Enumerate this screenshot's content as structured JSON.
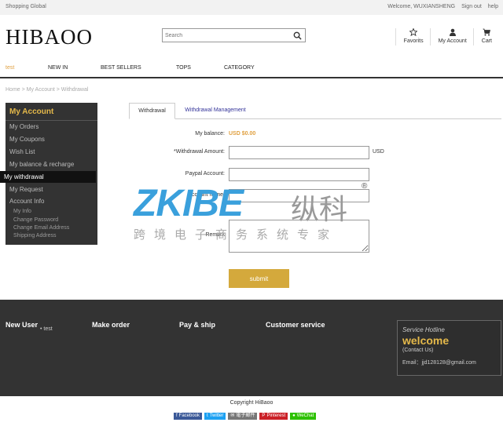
{
  "topbar": {
    "left": "Shopping Global",
    "welcome": "Welcome, WUXIANSHENG",
    "signout": "Sign out",
    "help": "help"
  },
  "header": {
    "logo": "HIBAOO",
    "search_placeholder": "Search",
    "favorites": "Favorits",
    "account": "My Account",
    "cart": "Cart"
  },
  "nav": [
    "test",
    "NEW IN",
    "BEST SELLERS",
    "TOPS",
    "CATEGORY"
  ],
  "breadcrumb": "Home > My Account > Withdrawal",
  "sidebar": {
    "title": "My Account",
    "items": [
      "My Orders",
      "My Coupons",
      "Wish List",
      "My balance & recharge",
      "My withdrawal",
      "My Request",
      "Account Info"
    ],
    "sub_items": [
      "My Info",
      "Change Password",
      "Change Email Address",
      "Shipping Address"
    ]
  },
  "tabs": {
    "active": "Withdrawal",
    "inactive": "Withdrawal Management"
  },
  "form": {
    "balance_label": "My balance:",
    "balance_value": "USD $0.00",
    "amount_label": "*Withdrawal Amount:",
    "amount_unit": "USD",
    "paypal_label": "Paypal Account:",
    "account_name_label": "Account name:",
    "remark_label": "Remark",
    "submit": "submit"
  },
  "watermark": {
    "text": "ZKIBE",
    "chinese": "纵科",
    "subtitle": "跨境电子商务系统专家",
    "reg": "®"
  },
  "footer": {
    "columns": [
      "New User",
      "Make order",
      "Pay & ship",
      "Customer service"
    ],
    "new_user_sub": "• test",
    "hotline_title": "Service Hotline",
    "hotline_big": "welcome",
    "hotline_contact": "(Contact Us)",
    "hotline_email": "Email：jjd128128@gmail.com"
  },
  "copyright": "Copyright HiBaoo",
  "share": [
    {
      "label": "Facebook",
      "color": "#3b5998"
    },
    {
      "label": "Twitter",
      "color": "#1da1f2"
    },
    {
      "label": "電子郵件",
      "color": "#777777"
    },
    {
      "label": "Pinterest",
      "color": "#cb2027"
    },
    {
      "label": "WeChat",
      "color": "#2dc100"
    }
  ]
}
